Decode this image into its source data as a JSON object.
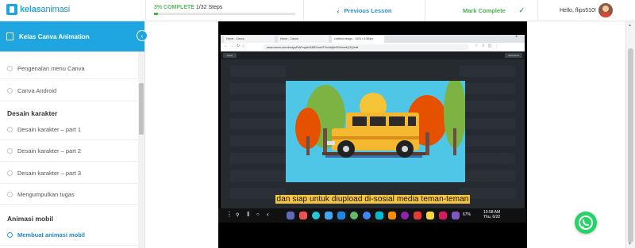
{
  "brand": {
    "part1": "kelas",
    "part2": "animasi"
  },
  "progress": {
    "label": "3% COMPLETE",
    "steps": "1/32 Steps",
    "percent": 3
  },
  "nav": {
    "prev": "Previous Lesson",
    "mark": "Mark Complete",
    "greeting": "Hello, flips510!"
  },
  "sidebar": {
    "course": "Kelas Canva Animation",
    "items": [
      {
        "type": "lesson",
        "label": "Pengenalan menu Canva"
      },
      {
        "type": "lesson",
        "label": "Canva Android"
      },
      {
        "type": "section",
        "label": "Desain karakter"
      },
      {
        "type": "lesson",
        "label": "Desain karakter – part 1"
      },
      {
        "type": "lesson",
        "label": "Desain karakter – part 2"
      },
      {
        "type": "lesson",
        "label": "Desain karakter – part 3"
      },
      {
        "type": "lesson",
        "label": "Mengumpulkan tugas"
      },
      {
        "type": "section",
        "label": "Animasi mobil"
      },
      {
        "type": "lesson",
        "label": "Membuat animasi mobil",
        "active": true
      }
    ]
  },
  "video": {
    "tabs": [
      "Home - Canva",
      "Home - Canva",
      "Untitled design - 1920 x 1080px"
    ],
    "url": "www.canva.com/design/DAFmgvb2kS8/2zwHT0o4dq0b4ShXsw4Q2Q/edit",
    "close_label": "Close",
    "download_label": "Download",
    "caption": "dan siap untuk diupload di-sosial media teman-teman",
    "status": "67%",
    "time": "10:58 AM",
    "date": "Thu, 6/22"
  },
  "colors": {
    "brand": "#1fa6e0",
    "complete": "#4caf50",
    "link": "#2a8fd0",
    "sky": "#4fc6e6",
    "car": "#f5b82e"
  }
}
